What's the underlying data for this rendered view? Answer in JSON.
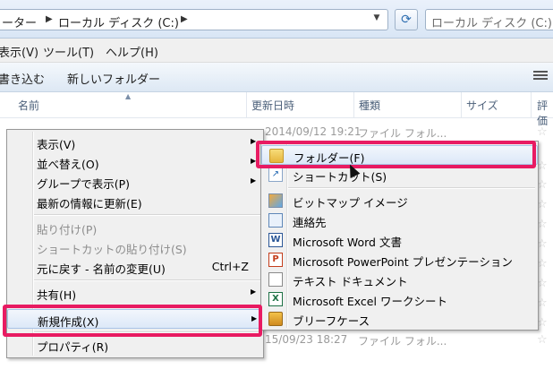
{
  "addressbar": {
    "crumbs": [
      "ーター",
      "ローカル ディスク (C:)"
    ],
    "search_placeholder": "ローカル ディスク (C:)の検索"
  },
  "menubar": {
    "items": [
      "表示(V)",
      "ツール(T)",
      "ヘルプ(H)"
    ]
  },
  "toolbar": {
    "items": [
      "書き込む",
      "新しいフォルダー"
    ]
  },
  "columns": {
    "name": "名前",
    "modified": "更新日時",
    "type": "種類",
    "size": "サイズ",
    "rating": "評価"
  },
  "file_rows": [
    {
      "date": "2014/09/12 19:21",
      "type": "ファイル フォル..."
    },
    {
      "date": "15/09/23 18:27",
      "type": "ファイル フォル..."
    }
  ],
  "context_menu": {
    "items": [
      {
        "label": "表示(V)",
        "submenu": true
      },
      {
        "label": "並べ替え(O)",
        "submenu": true
      },
      {
        "label": "グループで表示(P)",
        "submenu": true
      },
      {
        "label": "最新の情報に更新(E)"
      },
      {
        "label": "貼り付け(P)",
        "disabled": true
      },
      {
        "label": "ショートカットの貼り付け(S)",
        "disabled": true
      },
      {
        "label": "元に戻す - 名前の変更(U)",
        "shortcut": "Ctrl+Z"
      },
      {
        "label": "共有(H)",
        "submenu": true
      },
      {
        "label": "新規作成(X)",
        "submenu": true,
        "highlighted": true
      },
      {
        "label": "プロパティ(R)"
      }
    ]
  },
  "new_submenu": {
    "items": [
      {
        "label": "フォルダー(F)",
        "icon": "folder-icon",
        "highlighted": true
      },
      {
        "label": "ショートカット(S)",
        "icon": "shortcut-icon"
      },
      {
        "label": "ビットマップ イメージ",
        "icon": "bitmap-icon"
      },
      {
        "label": "連絡先",
        "icon": "contact-icon"
      },
      {
        "label": "Microsoft Word 文書",
        "icon": "word-icon"
      },
      {
        "label": "Microsoft PowerPoint プレゼンテーション",
        "icon": "powerpoint-icon"
      },
      {
        "label": "テキスト ドキュメント",
        "icon": "text-document-icon"
      },
      {
        "label": "Microsoft Excel ワークシート",
        "icon": "excel-icon"
      },
      {
        "label": "ブリーフケース",
        "icon": "briefcase-icon"
      }
    ]
  },
  "colors": {
    "highlight_box": "#e81b62",
    "menu_bg": "#f0f0f0"
  }
}
